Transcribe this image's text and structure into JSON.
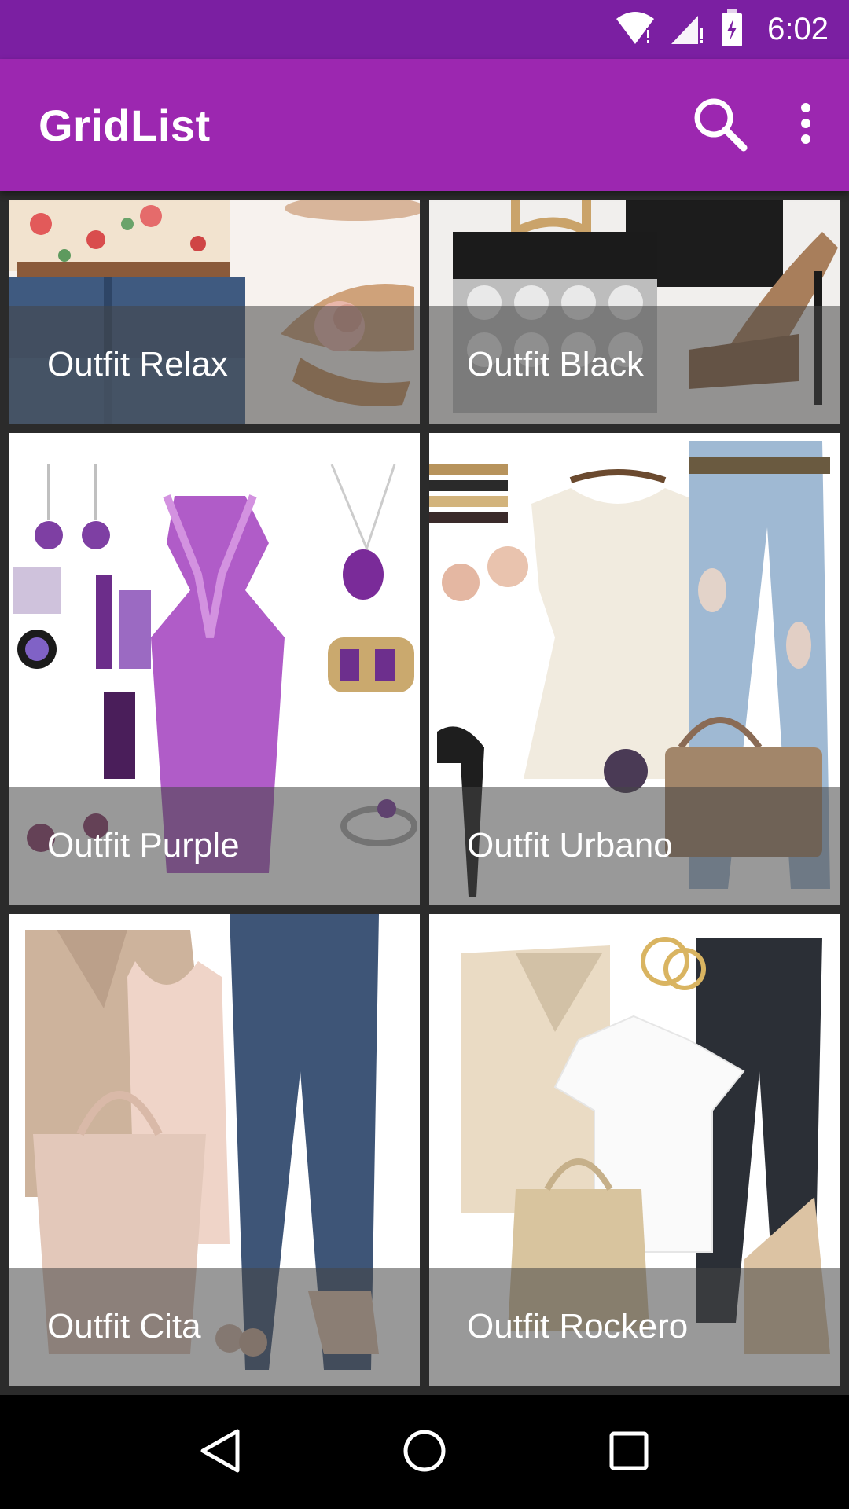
{
  "status_bar": {
    "time": "6:02",
    "icons": [
      "wifi-icon",
      "cell-signal-icon",
      "battery-charging-icon"
    ]
  },
  "app_bar": {
    "title": "GridList",
    "actions": [
      "search-icon",
      "more-vert-icon"
    ]
  },
  "grid": {
    "items": [
      {
        "label": "Outfit Relax"
      },
      {
        "label": "Outfit Black"
      },
      {
        "label": "Outfit Purple"
      },
      {
        "label": "Outfit Urbano"
      },
      {
        "label": "Outfit Cita"
      },
      {
        "label": "Outfit Rockero"
      }
    ]
  },
  "nav_bar": {
    "buttons": [
      "back-icon",
      "home-icon",
      "recents-icon"
    ]
  },
  "colors": {
    "status_bar": "#7b1fa2",
    "app_bar": "#9c27b0",
    "caption_overlay": "rgba(70,70,70,0.55)"
  }
}
